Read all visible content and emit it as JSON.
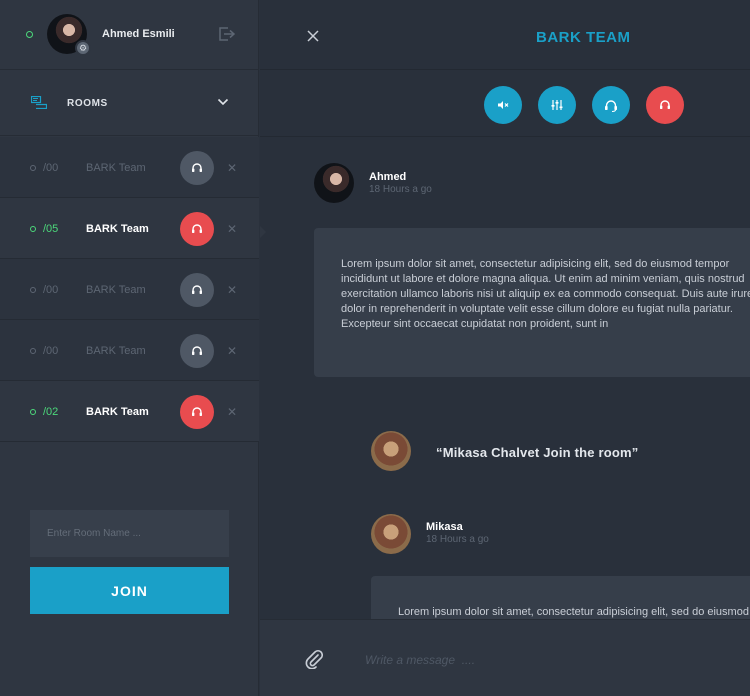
{
  "user": {
    "name": "Ahmed Esmili",
    "status": "online"
  },
  "sidebar": {
    "rooms_label": "ROOMS",
    "rooms": [
      {
        "num": "/00",
        "name": "BARK Team",
        "active": false
      },
      {
        "num": "/05",
        "name": "BARK Team",
        "active": true
      },
      {
        "num": "/00",
        "name": "BARK Team",
        "active": false
      },
      {
        "num": "/00",
        "name": "BARK Team",
        "active": false
      },
      {
        "num": "/02",
        "name": "BARK Team",
        "active": true
      }
    ],
    "room_input_placeholder": "Enter Room Name ...",
    "join_label": "JOIN"
  },
  "main": {
    "title": "BARK TEAM",
    "controls": [
      "mute-icon",
      "equalizer-icon",
      "headset-icon",
      "hangup-icon"
    ]
  },
  "messages": [
    {
      "sender": "Ahmed",
      "time": "18 Hours a go",
      "text": "Lorem ipsum dolor sit amet, consectetur adipisicing elit, sed do eiusmod tempor incididunt ut labore et dolore magna aliqua. Ut enim ad minim veniam, quis nostrud exercitation ullamco laboris nisi ut aliquip ex ea commodo consequat. Duis aute irure dolor in reprehenderit in voluptate velit esse cillum dolore eu fugiat nulla pariatur. Excepteur sint occaecat cupidatat non proident, sunt in"
    },
    {
      "system": "“Mikasa Chalvet Join the room”"
    },
    {
      "sender": "Mikasa",
      "time": "18 Hours a go",
      "text": "Lorem ipsum dolor sit amet, consectetur adipisicing elit, sed do eiusmod"
    }
  ],
  "composer": {
    "placeholder": "Write a message  ...."
  },
  "colors": {
    "accent": "#1aa0c8",
    "danger": "#e84c4f",
    "online": "#4cd97b"
  }
}
